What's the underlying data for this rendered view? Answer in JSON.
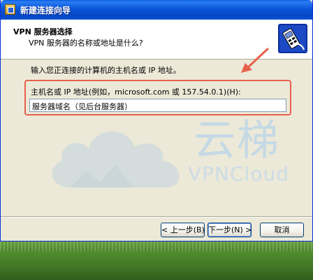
{
  "window": {
    "title": "新建连接向导"
  },
  "header": {
    "title": "VPN 服务器选择",
    "subtitle": "VPN 服务器的名称或地址是什么?",
    "icon": "vpn-server-icon"
  },
  "main": {
    "prompt": "输入您正连接的计算机的主机名或 IP 地址。",
    "host_label": "主机名或 IP 地址(例如，microsoft.com 或 157.54.0.1)(H):",
    "host_value": "服务器域名（见后台服务器）"
  },
  "watermark": {
    "chinese": "云梯",
    "english": "VPNCloud"
  },
  "buttons": {
    "back": "< 上一步(B)",
    "next": "下一步(N) >",
    "cancel": "取消"
  },
  "colors": {
    "titlebar": "#0a56d8",
    "highlight": "#e8604c",
    "watermark": "#b9d4ea"
  }
}
